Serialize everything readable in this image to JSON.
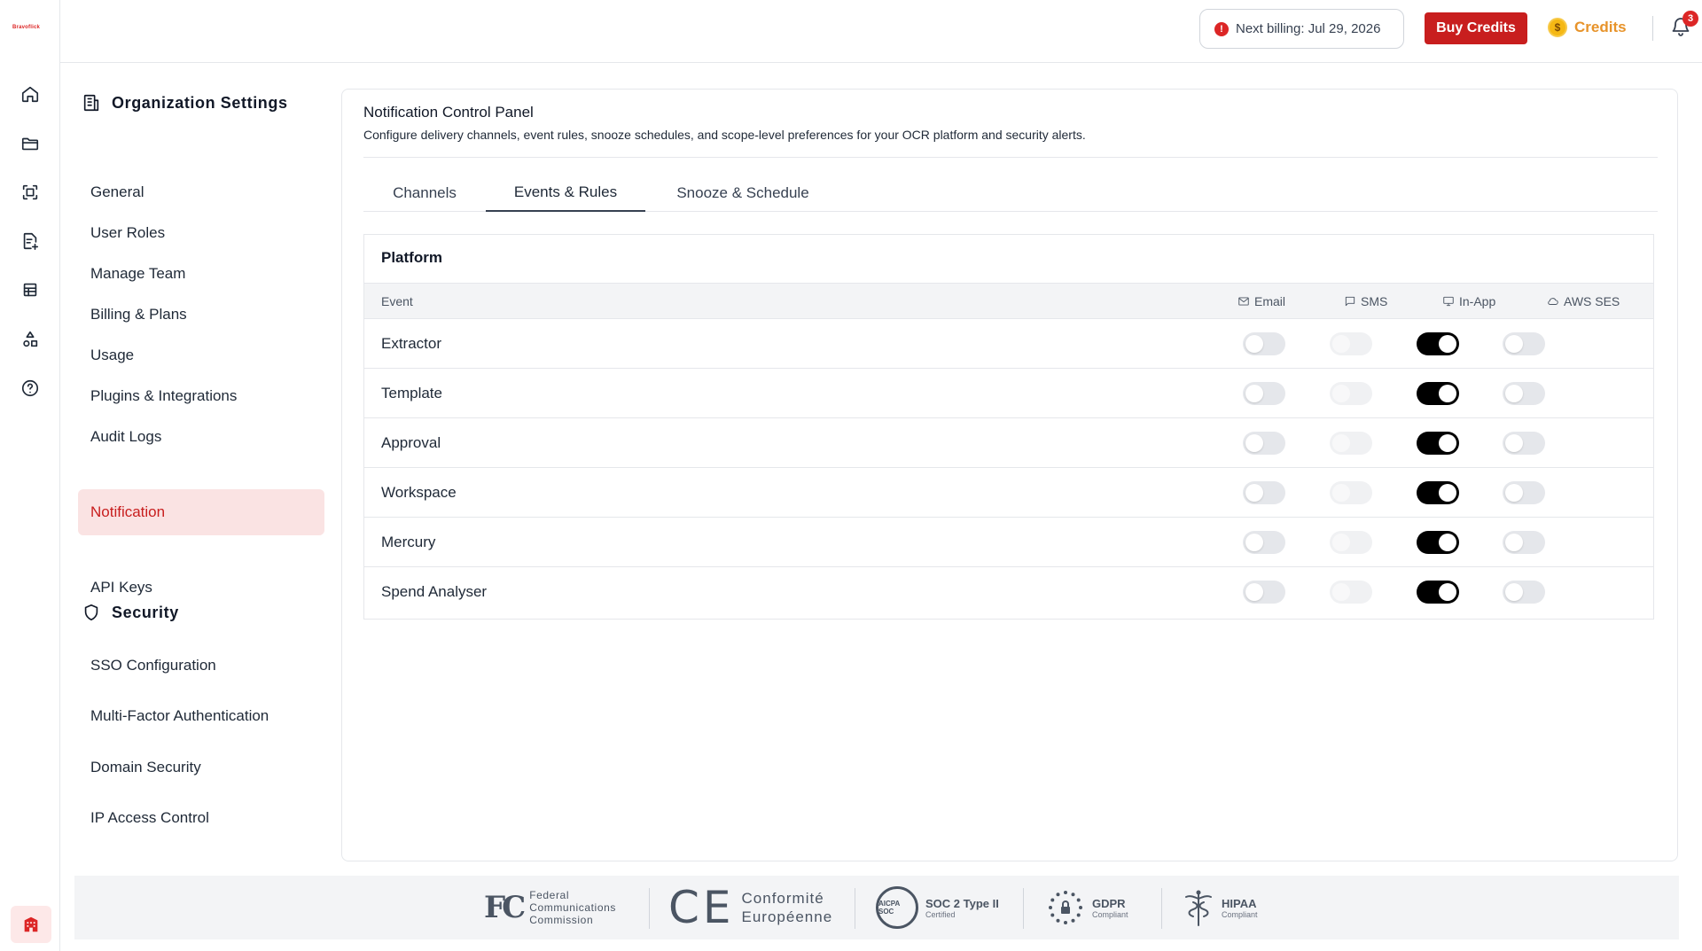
{
  "app": {
    "logo_text": "Bravoflick"
  },
  "rail": {
    "icons": [
      "home-icon",
      "folder-icon",
      "scan-icon",
      "document-add-icon",
      "table-icon",
      "shapes-icon",
      "help-circle-icon"
    ],
    "bottom_icon": "building-icon"
  },
  "topbar": {
    "billing_label": "Next billing: Jul 29, 2026",
    "alert_glyph": "!",
    "buy_credits": "Buy Credits",
    "coin_glyph": "$",
    "credits_label": "Credits",
    "notification_count": "3"
  },
  "sidebar": {
    "org_title": "Organization Settings",
    "org_items": [
      {
        "label": "General"
      },
      {
        "label": "User Roles"
      },
      {
        "label": "Manage Team"
      },
      {
        "label": "Billing & Plans"
      },
      {
        "label": "Usage"
      },
      {
        "label": "Plugins & Integrations"
      },
      {
        "label": "Audit Logs"
      },
      {
        "label": "Notification",
        "active": true
      },
      {
        "label": "API Keys"
      }
    ],
    "security_title": "Security",
    "security_items": [
      {
        "label": "SSO Configuration"
      },
      {
        "label": "Multi-Factor Authentication"
      },
      {
        "label": "Domain Security"
      },
      {
        "label": "IP Access Control"
      }
    ]
  },
  "panel": {
    "title": "Notification Control Panel",
    "subtitle": "Configure delivery channels, event rules, snooze schedules, and scope-level preferences for your OCR platform and security alerts.",
    "tabs": [
      {
        "label": "Channels"
      },
      {
        "label": "Events & Rules",
        "active": true
      },
      {
        "label": "Snooze & Schedule"
      }
    ],
    "card": {
      "title": "Platform",
      "columns": {
        "event": "Event",
        "email": "Email",
        "sms": "SMS",
        "inapp": "In-App",
        "ses": "AWS SES"
      },
      "rows": [
        {
          "event": "Extractor",
          "email": false,
          "sms": "disabled",
          "inapp": true,
          "ses": false
        },
        {
          "event": "Template",
          "email": false,
          "sms": "disabled",
          "inapp": true,
          "ses": false
        },
        {
          "event": "Approval",
          "email": false,
          "sms": "disabled",
          "inapp": true,
          "ses": false
        },
        {
          "event": "Workspace",
          "email": false,
          "sms": "disabled",
          "inapp": true,
          "ses": false
        },
        {
          "event": "Mercury",
          "email": false,
          "sms": "disabled",
          "inapp": true,
          "ses": false
        },
        {
          "event": "Spend Analyser",
          "email": false,
          "sms": "disabled",
          "inapp": true,
          "ses": false
        }
      ]
    }
  },
  "footer": {
    "fcc": {
      "mark": "FC",
      "line1": "Federal",
      "line2": "Communications",
      "line3": "Commission"
    },
    "ce": {
      "mark": "CE",
      "line1": "Conformité",
      "line2": "Européenne"
    },
    "soc": {
      "logo": "AICPA SOC",
      "title": "SOC 2 Type II",
      "sub": "Certified"
    },
    "gdpr": {
      "title": "GDPR",
      "sub": "Compliant"
    },
    "hipaa": {
      "title": "HIPAA",
      "sub": "Compliant"
    }
  }
}
